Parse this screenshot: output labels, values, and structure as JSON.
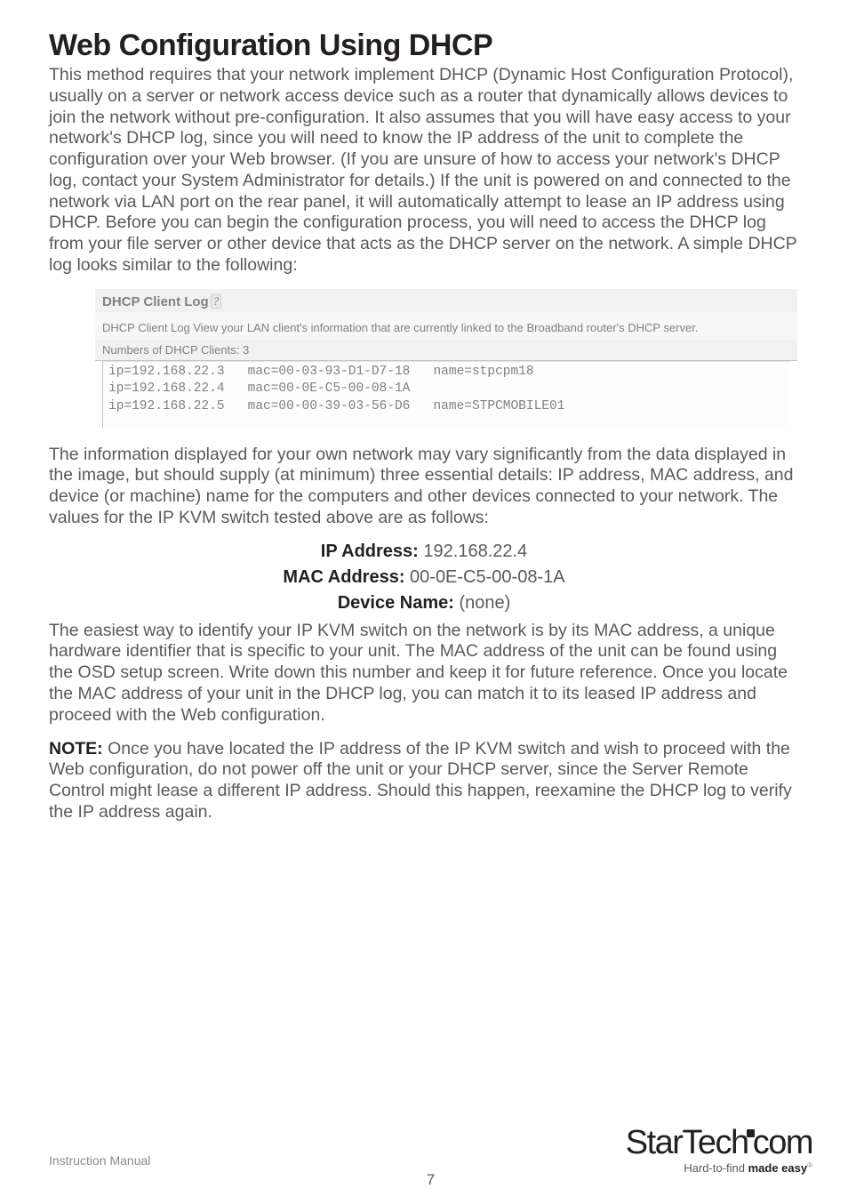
{
  "heading": "Web Configuration Using DHCP",
  "para1": "This method requires that your network implement DHCP (Dynamic Host Configuration Protocol), usually on a server or network access device such as a router that dynamically allows devices to join the network without pre-configuration. It also assumes that you will have easy access to your network's DHCP log, since you will need to know the IP address of the unit to complete the configuration over your Web browser. (If you are unsure of how to access your network's DHCP log, contact your System Administrator for details.) If the unit is powered on and connected to the network via LAN port on the rear panel, it will automatically attempt to lease an IP address using DHCP. Before you can begin the configuration process, you will need to access the DHCP log from your file server or other device that acts as the DHCP server on the network. A simple DHCP log looks similar to the following:",
  "shot": {
    "title": "DHCP Client Log ",
    "help_glyph": "?",
    "subtitle": "DHCP Client Log View your LAN client's information that are currently linked to the Broadband router's DHCP server.",
    "count_label": "Numbers of DHCP Clients: ",
    "count_value": "3",
    "pre": "ip=192.168.22.3   mac=00-03-93-D1-D7-18   name=stpcpm18\nip=192.168.22.4   mac=00-0E-C5-00-08-1A\nip=192.168.22.5   mac=00-00-39-03-56-D6   name=STPCMOBILE01"
  },
  "para2": "The information displayed for your own network may vary significantly from the data displayed in the image, but should supply (at minimum) three essential details: IP address, MAC address, and device (or machine) name for the computers and other devices connected to your network. The values for the IP KVM switch tested above are as follows:",
  "kv": {
    "ip_label": "IP Address: ",
    "ip_value": "192.168.22.4",
    "mac_label": "MAC Address: ",
    "mac_value": "00-0E-C5-00-08-1A",
    "name_label": "Device Name: ",
    "name_value": "(none)"
  },
  "para3": "The easiest way to identify your IP KVM switch on the network is by its MAC address, a unique hardware identifier that is specific to your unit. The MAC address of the unit can be found using the OSD setup screen. Write down this number and keep it for future reference. Once you locate the MAC address of your unit in the DHCP log, you can match it to its leased IP address and proceed with the Web configuration.",
  "note_label": "NOTE: ",
  "para4": "Once you have located the IP address of the IP KVM switch and wish to proceed with the Web configuration, do not power off the unit or your DHCP server, since the Server Remote Control might lease a different IP address. Should this happen, reexamine the DHCP log to verify the IP address again.",
  "footer": {
    "left": "Instruction Manual",
    "page": "7",
    "logo_a": "Star",
    "logo_b": "Tech",
    "logo_c": "com",
    "tag_a": "Hard-to-find ",
    "tag_b": "made easy",
    "reg": "®"
  }
}
